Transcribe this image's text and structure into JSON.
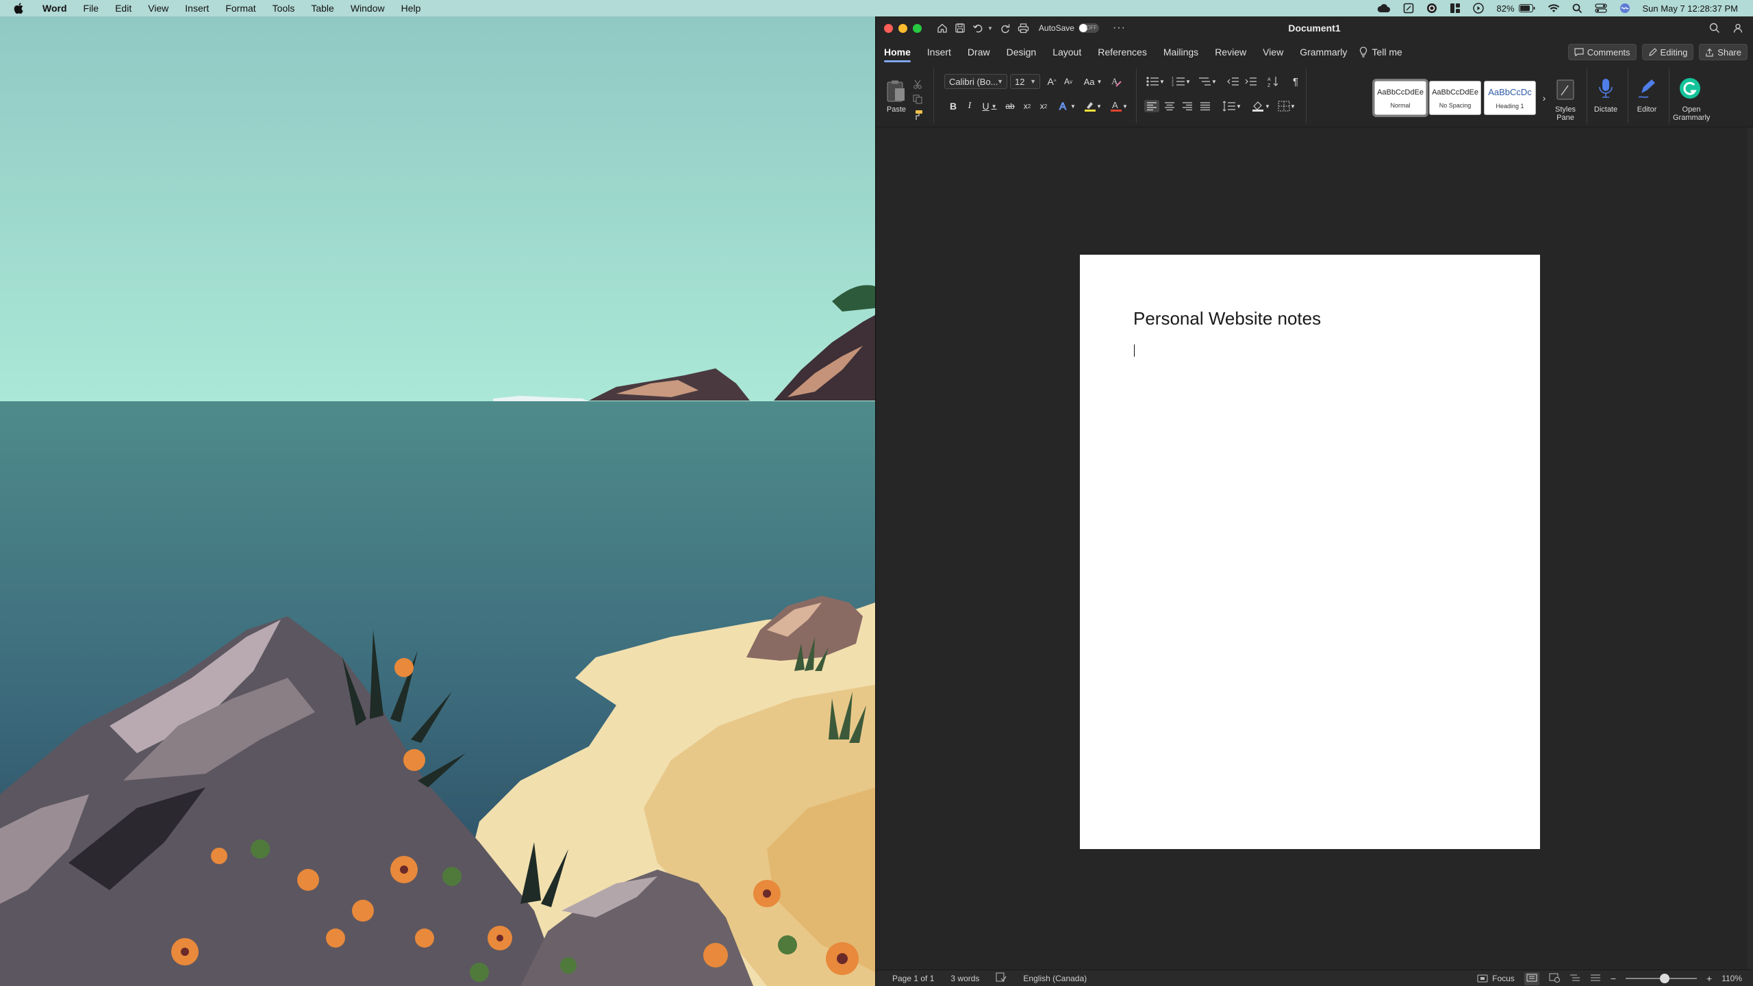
{
  "menubar": {
    "app_name": "Word",
    "menus": [
      "File",
      "Edit",
      "View",
      "Insert",
      "Format",
      "Tools",
      "Table",
      "Window",
      "Help"
    ],
    "battery": "82%",
    "datetime": "Sun May 7  12:28:37 PM"
  },
  "window": {
    "title": "Document1",
    "autosave_label": "AutoSave",
    "autosave_state": "OFF",
    "more": "···"
  },
  "ribbon_tabs": {
    "tabs": [
      "Home",
      "Insert",
      "Draw",
      "Design",
      "Layout",
      "References",
      "Mailings",
      "Review",
      "View",
      "Grammarly"
    ],
    "active": "Home",
    "tell_me": "Tell me",
    "comments": "Comments",
    "editing": "Editing",
    "share": "Share"
  },
  "ribbon": {
    "paste_label": "Paste",
    "font_name": "Calibri (Bo...",
    "font_size": "12",
    "case_label": "Aa",
    "styles": [
      {
        "sample": "AaBbCcDdEe",
        "name": "Normal"
      },
      {
        "sample": "AaBbCcDdEe",
        "name": "No Spacing"
      },
      {
        "sample": "AaBbCcDc",
        "name": "Heading 1"
      }
    ],
    "styles_pane_label": "Styles\nPane",
    "dictate_label": "Dictate",
    "editor_label": "Editor",
    "open_grammarly_label": "Open\nGrammarly"
  },
  "document": {
    "heading": "Personal Website notes"
  },
  "statusbar": {
    "page": "Page 1 of 1",
    "words": "3 words",
    "language": "English (Canada)",
    "focus": "Focus",
    "zoom": "110%",
    "zoom_level": 0.55
  },
  "colors": {
    "accent": "#7ea6f0",
    "window_bg": "#262626",
    "page_bg": "#ffffff"
  }
}
